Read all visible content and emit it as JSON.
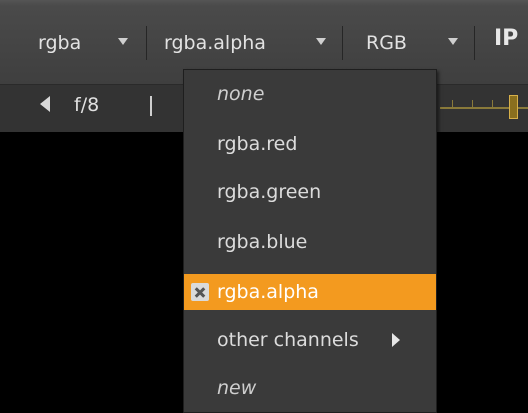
{
  "toolbar": {
    "channels_select": "rgba",
    "layer_select": "rgba.alpha",
    "display_select": "RGB",
    "ip_label": "IP",
    "fstop_label": "f/8"
  },
  "menu": {
    "items": [
      {
        "label": "none",
        "italic": true
      },
      {
        "label": "rgba.red"
      },
      {
        "label": "rgba.green"
      },
      {
        "label": "rgba.blue"
      },
      {
        "label": "rgba.alpha",
        "selected": true,
        "icon": "x-icon"
      },
      {
        "label": "other channels",
        "submenu": true
      },
      {
        "label": "new",
        "italic": true
      }
    ]
  },
  "colors": {
    "selection": "#f39a1f",
    "menu_bg": "#3a3a3a",
    "toolbar_bg": "#444444"
  }
}
